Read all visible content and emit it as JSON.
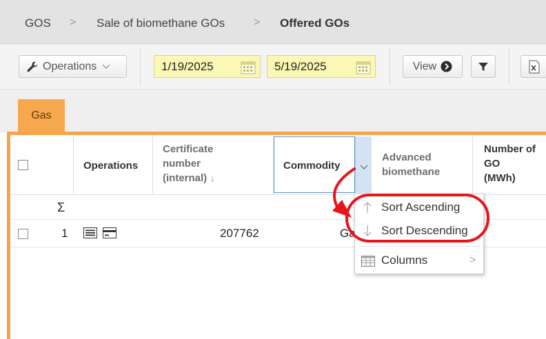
{
  "breadcrumb": {
    "items": [
      "GOS",
      "Sale of biomethane GOs",
      "Offered GOs"
    ],
    "separator": ">"
  },
  "toolbar": {
    "operations_label": "Operations",
    "date_from": "1/19/2025",
    "date_to": "5/19/2025",
    "view_label": "View"
  },
  "tabs": [
    {
      "label": "Gas",
      "active": true
    }
  ],
  "grid": {
    "headers": {
      "operations": "Operations",
      "certificate_number": [
        "Certificate",
        "number",
        "(internal)"
      ],
      "certificate_sort_arrow": "↓",
      "commodity": "Commodity",
      "advanced_biomethane": [
        "Advanced",
        "biomethane"
      ],
      "number_of_go": [
        "Number of",
        "GO",
        "(MWh)"
      ]
    },
    "summary_symbol": "Σ",
    "rows": [
      {
        "index": "1",
        "certificate_number": "207762",
        "commodity": "Ga"
      }
    ]
  },
  "column_menu": {
    "items": [
      {
        "label": "Sort Ascending",
        "icon": "arrow-up-icon"
      },
      {
        "label": "Sort Descending",
        "icon": "arrow-down-icon"
      },
      {
        "label": "Columns",
        "icon": "columns-icon",
        "submenu": true
      }
    ],
    "submenu_arrow": ">"
  },
  "colors": {
    "accent_orange": "#f6a34a",
    "date_field_bg": "#fbf7b4",
    "annotation_red": "#e8141b",
    "focus_blue": "#5b8fd0"
  }
}
